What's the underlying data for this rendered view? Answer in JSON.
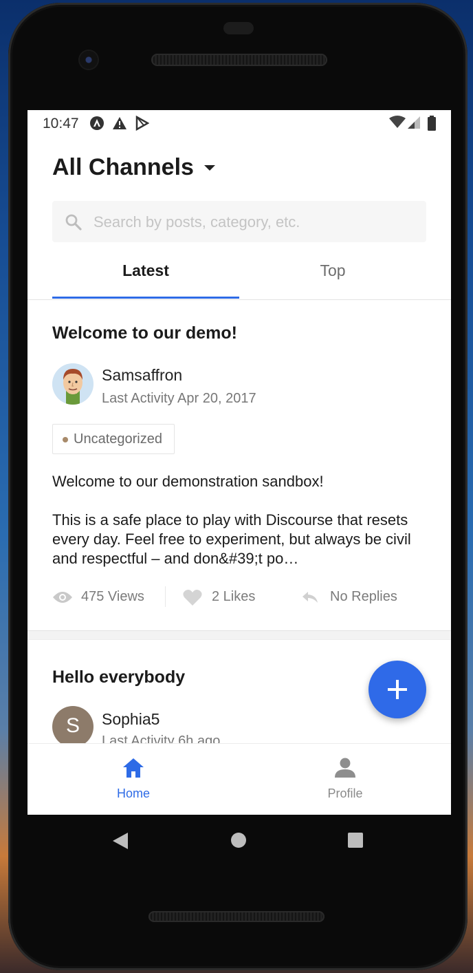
{
  "status_bar": {
    "time": "10:47",
    "left_icons": [
      "app-notification-icon",
      "warning-icon",
      "play-store-icon"
    ],
    "right_icons": [
      "wifi-icon",
      "cell-signal-icon",
      "battery-icon"
    ]
  },
  "header": {
    "title": "All Channels",
    "dropdown_icon": "caret-down-icon"
  },
  "search": {
    "placeholder": "Search by posts, category, etc.",
    "value": ""
  },
  "tabs": [
    {
      "label": "Latest",
      "active": true
    },
    {
      "label": "Top",
      "active": false
    }
  ],
  "posts": [
    {
      "title": "Welcome to our demo!",
      "author": "Samsaffron",
      "activity": "Last Activity Apr 20, 2017",
      "category": "Uncategorized",
      "category_color": "#a88a6a",
      "excerpt_intro": "Welcome to our demonstration sandbox!",
      "excerpt_body": "This is a safe place to play with Discourse that resets every day. Feel free to experiment, but always be civil and respectful – and don&#39;t po…",
      "views": "475 Views",
      "likes": "2 Likes",
      "replies": "No Replies"
    },
    {
      "title": "Hello everybody",
      "author": "Sophia5",
      "avatar_letter": "S",
      "activity": "Last Activity 6h ago"
    }
  ],
  "fab": {
    "icon": "plus-icon"
  },
  "bottom_nav": [
    {
      "label": "Home",
      "icon": "home-icon",
      "active": true
    },
    {
      "label": "Profile",
      "icon": "person-icon",
      "active": false
    }
  ],
  "colors": {
    "accent": "#2e6be6",
    "fab": "#2f6ae8",
    "avatar_sophia": "#8d7b6a"
  }
}
